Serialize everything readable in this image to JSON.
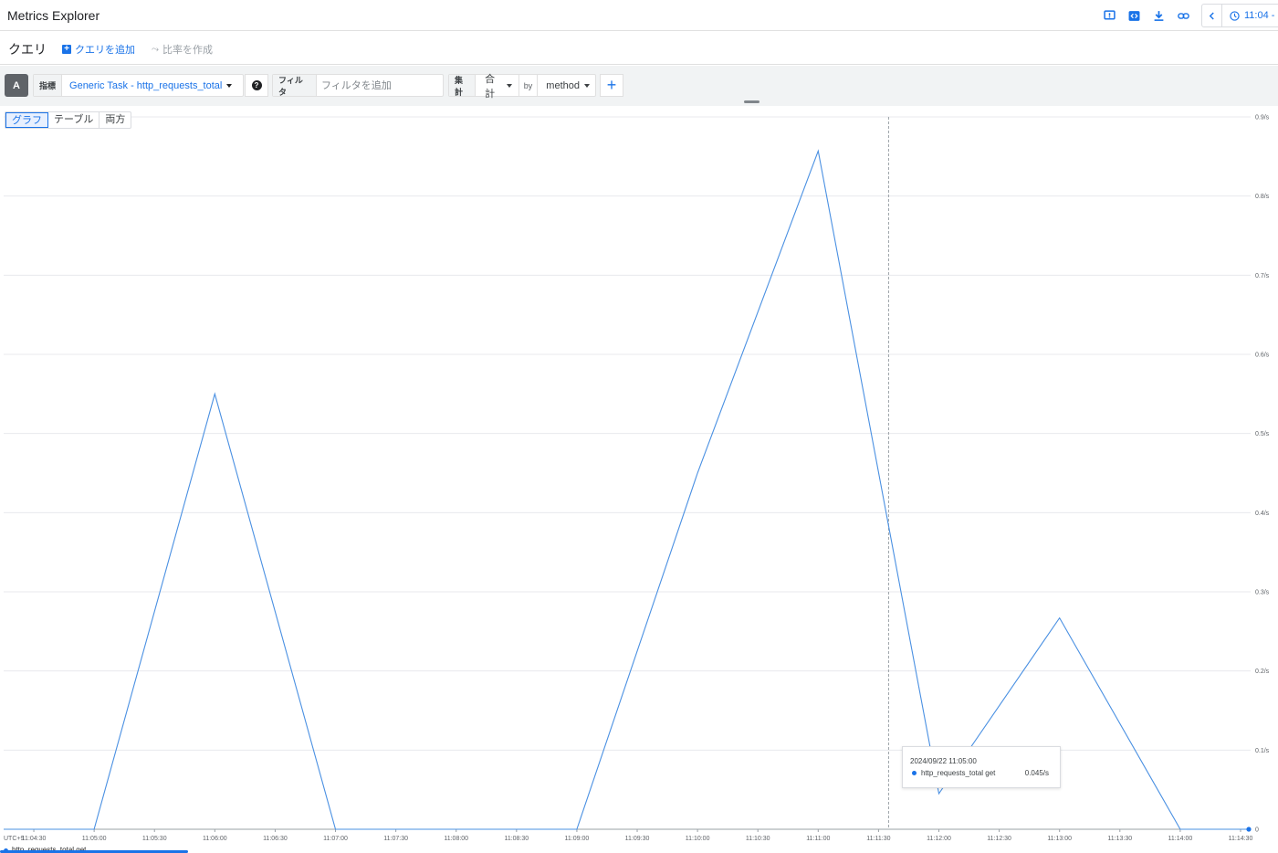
{
  "app": {
    "title": "Metrics Explorer"
  },
  "header": {
    "icons": [
      "feedback-icon",
      "code-icon",
      "download-icon",
      "link-icon"
    ],
    "time_label": "11:04 -"
  },
  "query_bar": {
    "label": "クエリ",
    "add_query": "クエリを追加",
    "make_ratio": "比率を作成"
  },
  "builder": {
    "query_letter": "A",
    "metric_tag": "指標",
    "metric_value": "Generic Task - http_requests_total",
    "filter_tag": "フィルタ",
    "filter_placeholder": "フィルタを追加",
    "agg_tag": "集計",
    "agg_value": "合計",
    "by_label": "by",
    "group_by": "method",
    "add_clause": "+"
  },
  "view_toggle": {
    "graph": "グラフ",
    "table": "テーブル",
    "both": "両方",
    "active": "graph"
  },
  "tooltip": {
    "time": "2024/09/22 11:05:00",
    "series": "http_requests_total get",
    "value": "0.045/s"
  },
  "legend": {
    "series": "http_requests_total get"
  },
  "colors": {
    "accent": "#1a73e8",
    "line": "#4a90e2",
    "grid": "#e8eaed"
  },
  "chart_data": {
    "type": "line",
    "timezone_label": "UTC+9",
    "x_ticks": [
      "11:04:30",
      "11:05:00",
      "11:05:30",
      "11:06:00",
      "11:06:30",
      "11:07:00",
      "11:07:30",
      "11:08:00",
      "11:08:30",
      "11:09:00",
      "11:09:30",
      "11:10:00",
      "11:10:30",
      "11:11:00",
      "11:11:30",
      "11:12:00",
      "11:12:30",
      "11:13:00",
      "11:13:30",
      "11:14:00",
      "11:14:30"
    ],
    "y_ticks": [
      "0",
      "0.1/s",
      "0.2/s",
      "0.3/s",
      "0.4/s",
      "0.5/s",
      "0.6/s",
      "0.7/s",
      "0.8/s",
      "0.9/s"
    ],
    "ylim": [
      0,
      0.9
    ],
    "xlim": [
      "11:04:15",
      "11:14:35"
    ],
    "cursor_time": "11:11:35",
    "series": [
      {
        "name": "http_requests_total get",
        "x": [
          "11:04:15",
          "11:05:00",
          "11:06:00",
          "11:07:00",
          "11:08:00",
          "11:09:00",
          "11:10:00",
          "11:11:00",
          "11:12:00",
          "11:13:00",
          "11:14:00",
          "11:14:35"
        ],
        "values": [
          0,
          0,
          0.55,
          0,
          0,
          0,
          0.45,
          0.857,
          0.045,
          0.267,
          0,
          0
        ]
      }
    ]
  }
}
